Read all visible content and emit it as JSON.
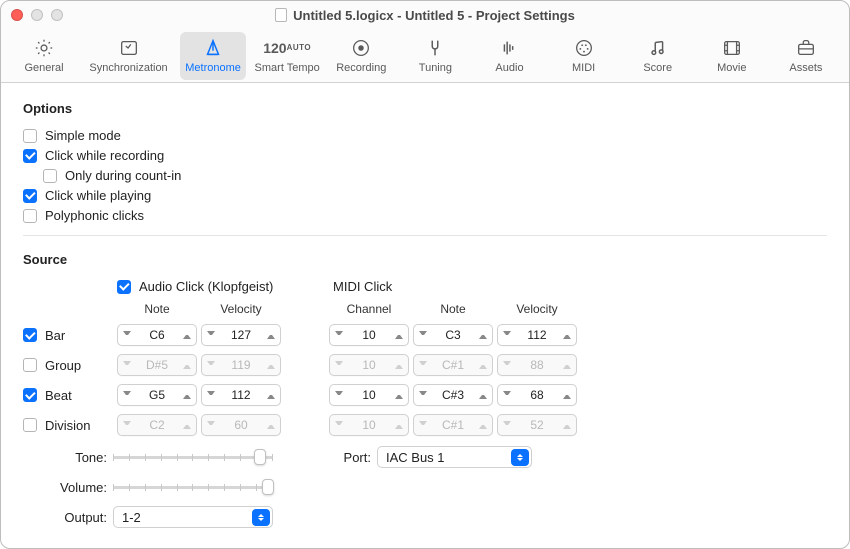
{
  "window": {
    "title": "Untitled 5.logicx - Untitled 5 - Project Settings"
  },
  "toolbar": {
    "general": "General",
    "sync": "Synchronization",
    "metronome": "Metronome",
    "smartTempo": "Smart Tempo",
    "tempoNumber": "120",
    "tempoAuto": "AUTO",
    "recording": "Recording",
    "tuning": "Tuning",
    "audio": "Audio",
    "midi": "MIDI",
    "score": "Score",
    "movie": "Movie",
    "assets": "Assets",
    "active": "metronome"
  },
  "options": {
    "heading": "Options",
    "simpleMode": {
      "label": "Simple mode",
      "checked": false
    },
    "clickRecording": {
      "label": "Click while recording",
      "checked": true
    },
    "onlyCountIn": {
      "label": "Only during count-in",
      "checked": false
    },
    "clickPlaying": {
      "label": "Click while playing",
      "checked": true
    },
    "polyphonic": {
      "label": "Polyphonic clicks",
      "checked": false
    }
  },
  "source": {
    "heading": "Source",
    "audioClick": {
      "label": "Audio Click (Klopfgeist)",
      "checked": true
    },
    "midiClick": {
      "label": "MIDI Click"
    },
    "cols": {
      "note": "Note",
      "velocity": "Velocity",
      "channel": "Channel"
    },
    "rows": {
      "bar": {
        "label": "Bar",
        "checked": true,
        "note": "C6",
        "velocity": "127",
        "midiCh": "10",
        "midiNote": "C3",
        "midiVel": "112"
      },
      "group": {
        "label": "Group",
        "checked": false,
        "note": "D#5",
        "velocity": "119",
        "midiCh": "10",
        "midiNote": "C#1",
        "midiVel": "88"
      },
      "beat": {
        "label": "Beat",
        "checked": true,
        "note": "G5",
        "velocity": "112",
        "midiCh": "10",
        "midiNote": "C#3",
        "midiVel": "68"
      },
      "division": {
        "label": "Division",
        "checked": false,
        "note": "C2",
        "velocity": "60",
        "midiCh": "10",
        "midiNote": "C#1",
        "midiVel": "52"
      }
    },
    "toneLabel": "Tone:",
    "volumeLabel": "Volume:",
    "outputLabel": "Output:",
    "outputValue": "1-2",
    "portLabel": "Port:",
    "portValue": "IAC Bus 1"
  }
}
